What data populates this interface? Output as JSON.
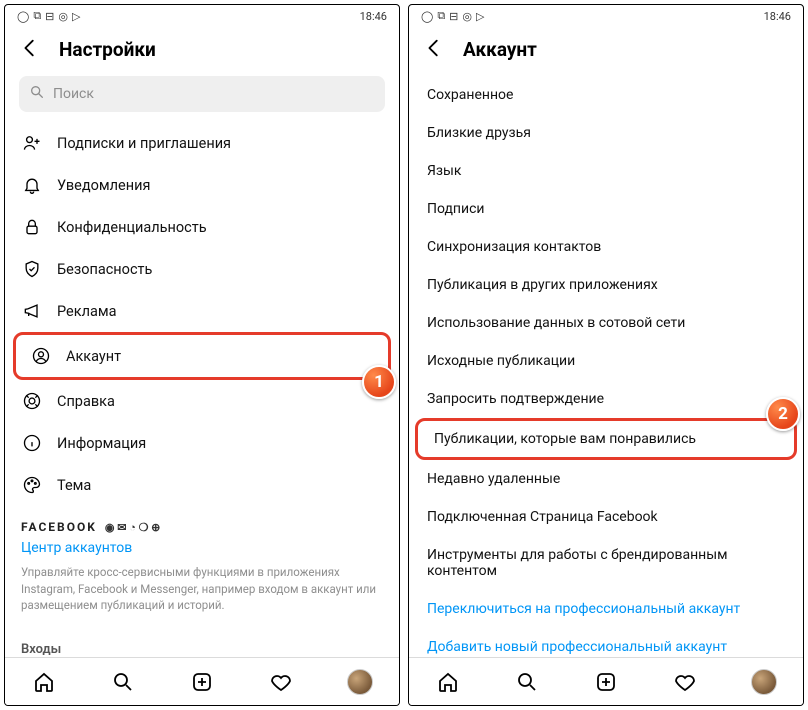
{
  "status": {
    "time": "18:46"
  },
  "left": {
    "title": "Настройки",
    "search_placeholder": "Поиск",
    "items": [
      {
        "label": "Подписки и приглашения"
      },
      {
        "label": "Уведомления"
      },
      {
        "label": "Конфиденциальность"
      },
      {
        "label": "Безопасность"
      },
      {
        "label": "Реклама"
      },
      {
        "label": "Аккаунт"
      },
      {
        "label": "Справка"
      },
      {
        "label": "Информация"
      },
      {
        "label": "Тема"
      }
    ],
    "facebook_brand": "FACEBOOK",
    "accounts_center": "Центр аккаунтов",
    "desc": "Управляйте кросс-сервисными функциями в приложениях Instagram, Facebook и Messenger, например входом в аккаунт или размещением публикаций и историй.",
    "logins_title": "Входы",
    "badge1": "1"
  },
  "right": {
    "title": "Аккаунт",
    "items": [
      "Сохраненное",
      "Близкие друзья",
      "Язык",
      "Подписи",
      "Синхронизация контактов",
      "Публикация в других приложениях",
      "Использование данных в сотовой сети",
      "Исходные публикации",
      "Запросить подтверждение",
      "Публикации, которые вам понравились",
      "Недавно удаленные",
      "Подключенная Страница Facebook",
      "Инструменты для работы с брендированным контентом"
    ],
    "link1": "Переключиться на профессиональный аккаунт",
    "link2": "Добавить новый профессиональный аккаунт",
    "badge2": "2"
  }
}
